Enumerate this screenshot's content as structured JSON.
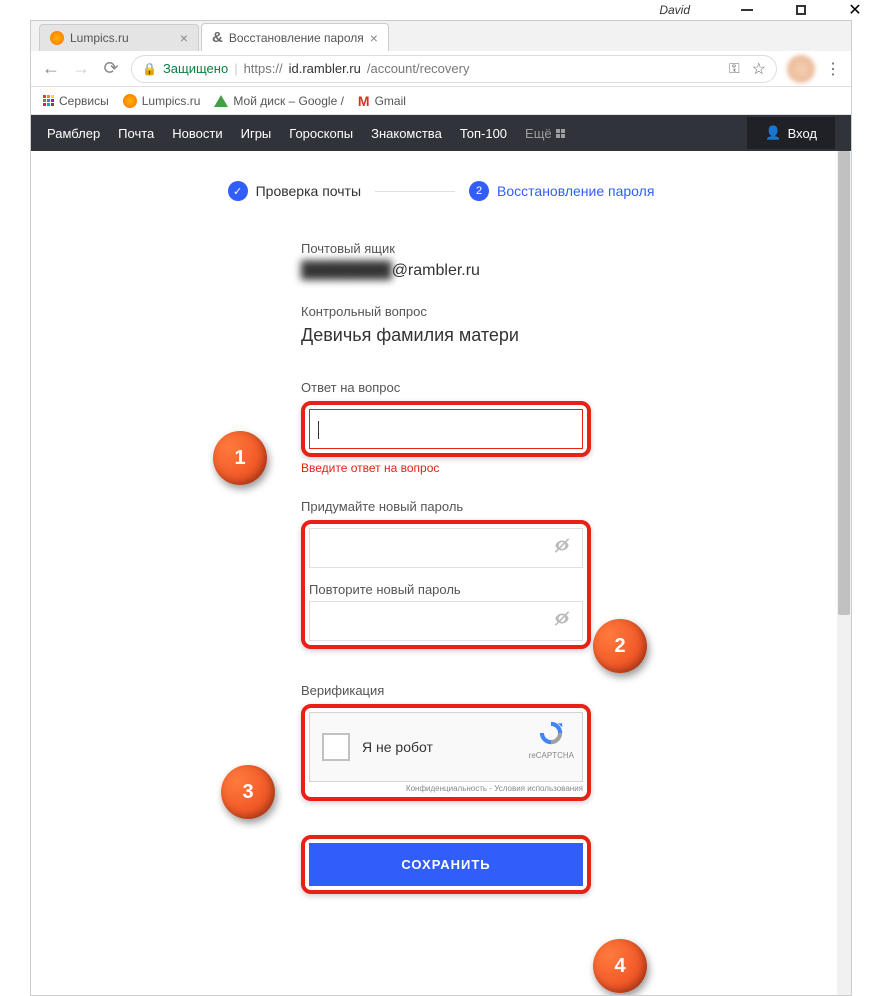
{
  "window": {
    "user": "David"
  },
  "tabs": [
    {
      "title": "Lumpics.ru",
      "active": false
    },
    {
      "title": "Восстановление пароля",
      "active": true
    }
  ],
  "url": {
    "secure_label": "Защищено",
    "protocol": "https://",
    "host": "id.rambler.ru",
    "path": "/account/recovery"
  },
  "bookmarks": {
    "services": "Сервисы",
    "lumpics": "Lumpics.ru",
    "drive": "Мой диск – Google /",
    "gmail": "Gmail"
  },
  "nav": {
    "items": [
      "Рамблер",
      "Почта",
      "Новости",
      "Игры",
      "Гороскопы",
      "Знакомства",
      "Топ-100"
    ],
    "more": "Ещё",
    "login": "Вход"
  },
  "steps": {
    "step1": "Проверка почты",
    "step2": "Восстановление пароля"
  },
  "form": {
    "mailbox_label": "Почтовый ящик",
    "mailbox_value_suffix": "@rambler.ru",
    "question_label": "Контрольный вопрос",
    "question_value": "Девичья фамилия матери",
    "answer_label": "Ответ на вопрос",
    "answer_error": "Введите ответ на вопрос",
    "new_pw_label": "Придумайте новый пароль",
    "repeat_pw_label": "Повторите новый пароль",
    "verification_label": "Верификация",
    "captcha_label": "Я не робот",
    "captcha_brand": "reCAPTCHA",
    "captcha_footer": "Конфиденциальность - Условия использования",
    "save_button": "СОХРАНИТЬ"
  },
  "markers": {
    "m1": "1",
    "m2": "2",
    "m3": "3",
    "m4": "4"
  }
}
